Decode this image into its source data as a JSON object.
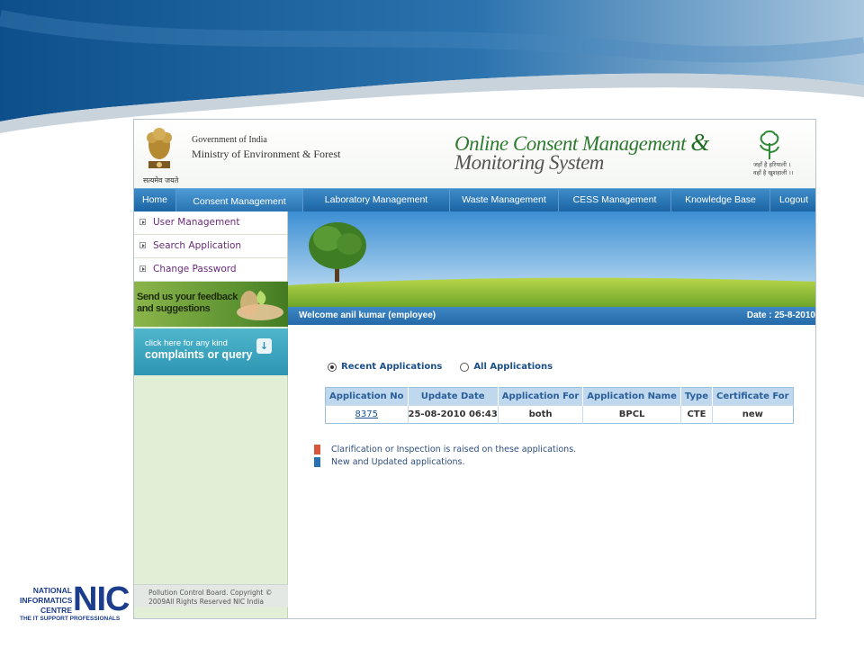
{
  "header": {
    "motto": "सत्यमेव जयते",
    "gov_line1": "Government of India",
    "gov_line2": "Ministry of Environment & Forest",
    "title_line1": "Online Consent Management",
    "title_amp": "&",
    "title_line2": "Monitoring System",
    "slogan_line1": "जहाँ है हरियाली ।",
    "slogan_line2": "वहाँ है खुशहाली ।।"
  },
  "nav": {
    "items": [
      {
        "label": "Home"
      },
      {
        "label": "Consent Management"
      },
      {
        "label": "Laboratory Management"
      },
      {
        "label": "Waste Management"
      },
      {
        "label": "CESS Management"
      },
      {
        "label": "Knowledge Base"
      },
      {
        "label": "Logout"
      }
    ]
  },
  "sidebar": {
    "items": [
      {
        "label": "User Management"
      },
      {
        "label": "Search Application"
      },
      {
        "label": "Change Password"
      }
    ],
    "feedback_line1": "Send us your feedback",
    "feedback_line2": "and suggestions",
    "complaint_small": "click here for any kind",
    "complaint_big": "complaints or query",
    "footer_line1": "Pollution Control Board. Copyright ©",
    "footer_line2": "2009All Rights Reserved NIC India"
  },
  "welcome": {
    "text": "Welcome anil kumar (employee)",
    "date": "Date : 25-8-2010"
  },
  "filters": {
    "recent": "Recent Applications",
    "all": "All Applications",
    "selected": "recent"
  },
  "table": {
    "headers": [
      "Application No",
      "Update Date",
      "Application For",
      "Application Name",
      "Type",
      "Certificate For"
    ],
    "rows": [
      {
        "app_no": "8375",
        "update_date": "25-08-2010 06:43",
        "app_for": "both",
        "app_name": "BPCL",
        "type": "CTE",
        "cert_for": "new"
      }
    ]
  },
  "legend": [
    {
      "color": "#d9583b",
      "text": "Clarification or Inspection is raised on these applications."
    },
    {
      "color": "#2a72b5",
      "text": "New and Updated applications."
    }
  ],
  "nic": {
    "line1": "NATIONAL",
    "line2": "INFORMATICS",
    "line3": "CENTRE",
    "big": "NIC",
    "tagline": "THE IT SUPPORT PROFESSIONALS"
  },
  "colors": {
    "nav": "#2469a8",
    "link_purple": "#6a2b7a",
    "sidebar_bg": "#e2efd7"
  }
}
